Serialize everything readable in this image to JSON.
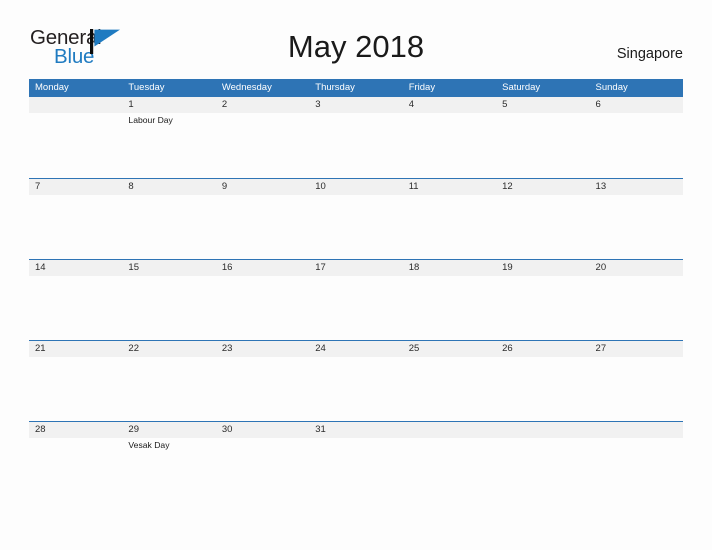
{
  "brand": {
    "name_part1": "General",
    "name_part2": "Blue",
    "flag_icon": "flag-icon",
    "dark_color": "#231f20",
    "blue_color": "#1f7bc1"
  },
  "header": {
    "title": "May 2018",
    "country": "Singapore",
    "accent_color": "#2e74b5",
    "band_color": "#f1f1f1"
  },
  "weekdays": [
    "Monday",
    "Tuesday",
    "Wednesday",
    "Thursday",
    "Friday",
    "Saturday",
    "Sunday"
  ],
  "weeks": [
    {
      "days": [
        {
          "num": "",
          "events": []
        },
        {
          "num": "1",
          "events": [
            "Labour Day"
          ]
        },
        {
          "num": "2",
          "events": []
        },
        {
          "num": "3",
          "events": []
        },
        {
          "num": "4",
          "events": []
        },
        {
          "num": "5",
          "events": []
        },
        {
          "num": "6",
          "events": []
        }
      ]
    },
    {
      "days": [
        {
          "num": "7",
          "events": []
        },
        {
          "num": "8",
          "events": []
        },
        {
          "num": "9",
          "events": []
        },
        {
          "num": "10",
          "events": []
        },
        {
          "num": "11",
          "events": []
        },
        {
          "num": "12",
          "events": []
        },
        {
          "num": "13",
          "events": []
        }
      ]
    },
    {
      "days": [
        {
          "num": "14",
          "events": []
        },
        {
          "num": "15",
          "events": []
        },
        {
          "num": "16",
          "events": []
        },
        {
          "num": "17",
          "events": []
        },
        {
          "num": "18",
          "events": []
        },
        {
          "num": "19",
          "events": []
        },
        {
          "num": "20",
          "events": []
        }
      ]
    },
    {
      "days": [
        {
          "num": "21",
          "events": []
        },
        {
          "num": "22",
          "events": []
        },
        {
          "num": "23",
          "events": []
        },
        {
          "num": "24",
          "events": []
        },
        {
          "num": "25",
          "events": []
        },
        {
          "num": "26",
          "events": []
        },
        {
          "num": "27",
          "events": []
        }
      ]
    },
    {
      "days": [
        {
          "num": "28",
          "events": []
        },
        {
          "num": "29",
          "events": [
            "Vesak Day"
          ]
        },
        {
          "num": "30",
          "events": []
        },
        {
          "num": "31",
          "events": []
        },
        {
          "num": "",
          "events": []
        },
        {
          "num": "",
          "events": []
        },
        {
          "num": "",
          "events": []
        }
      ]
    }
  ]
}
